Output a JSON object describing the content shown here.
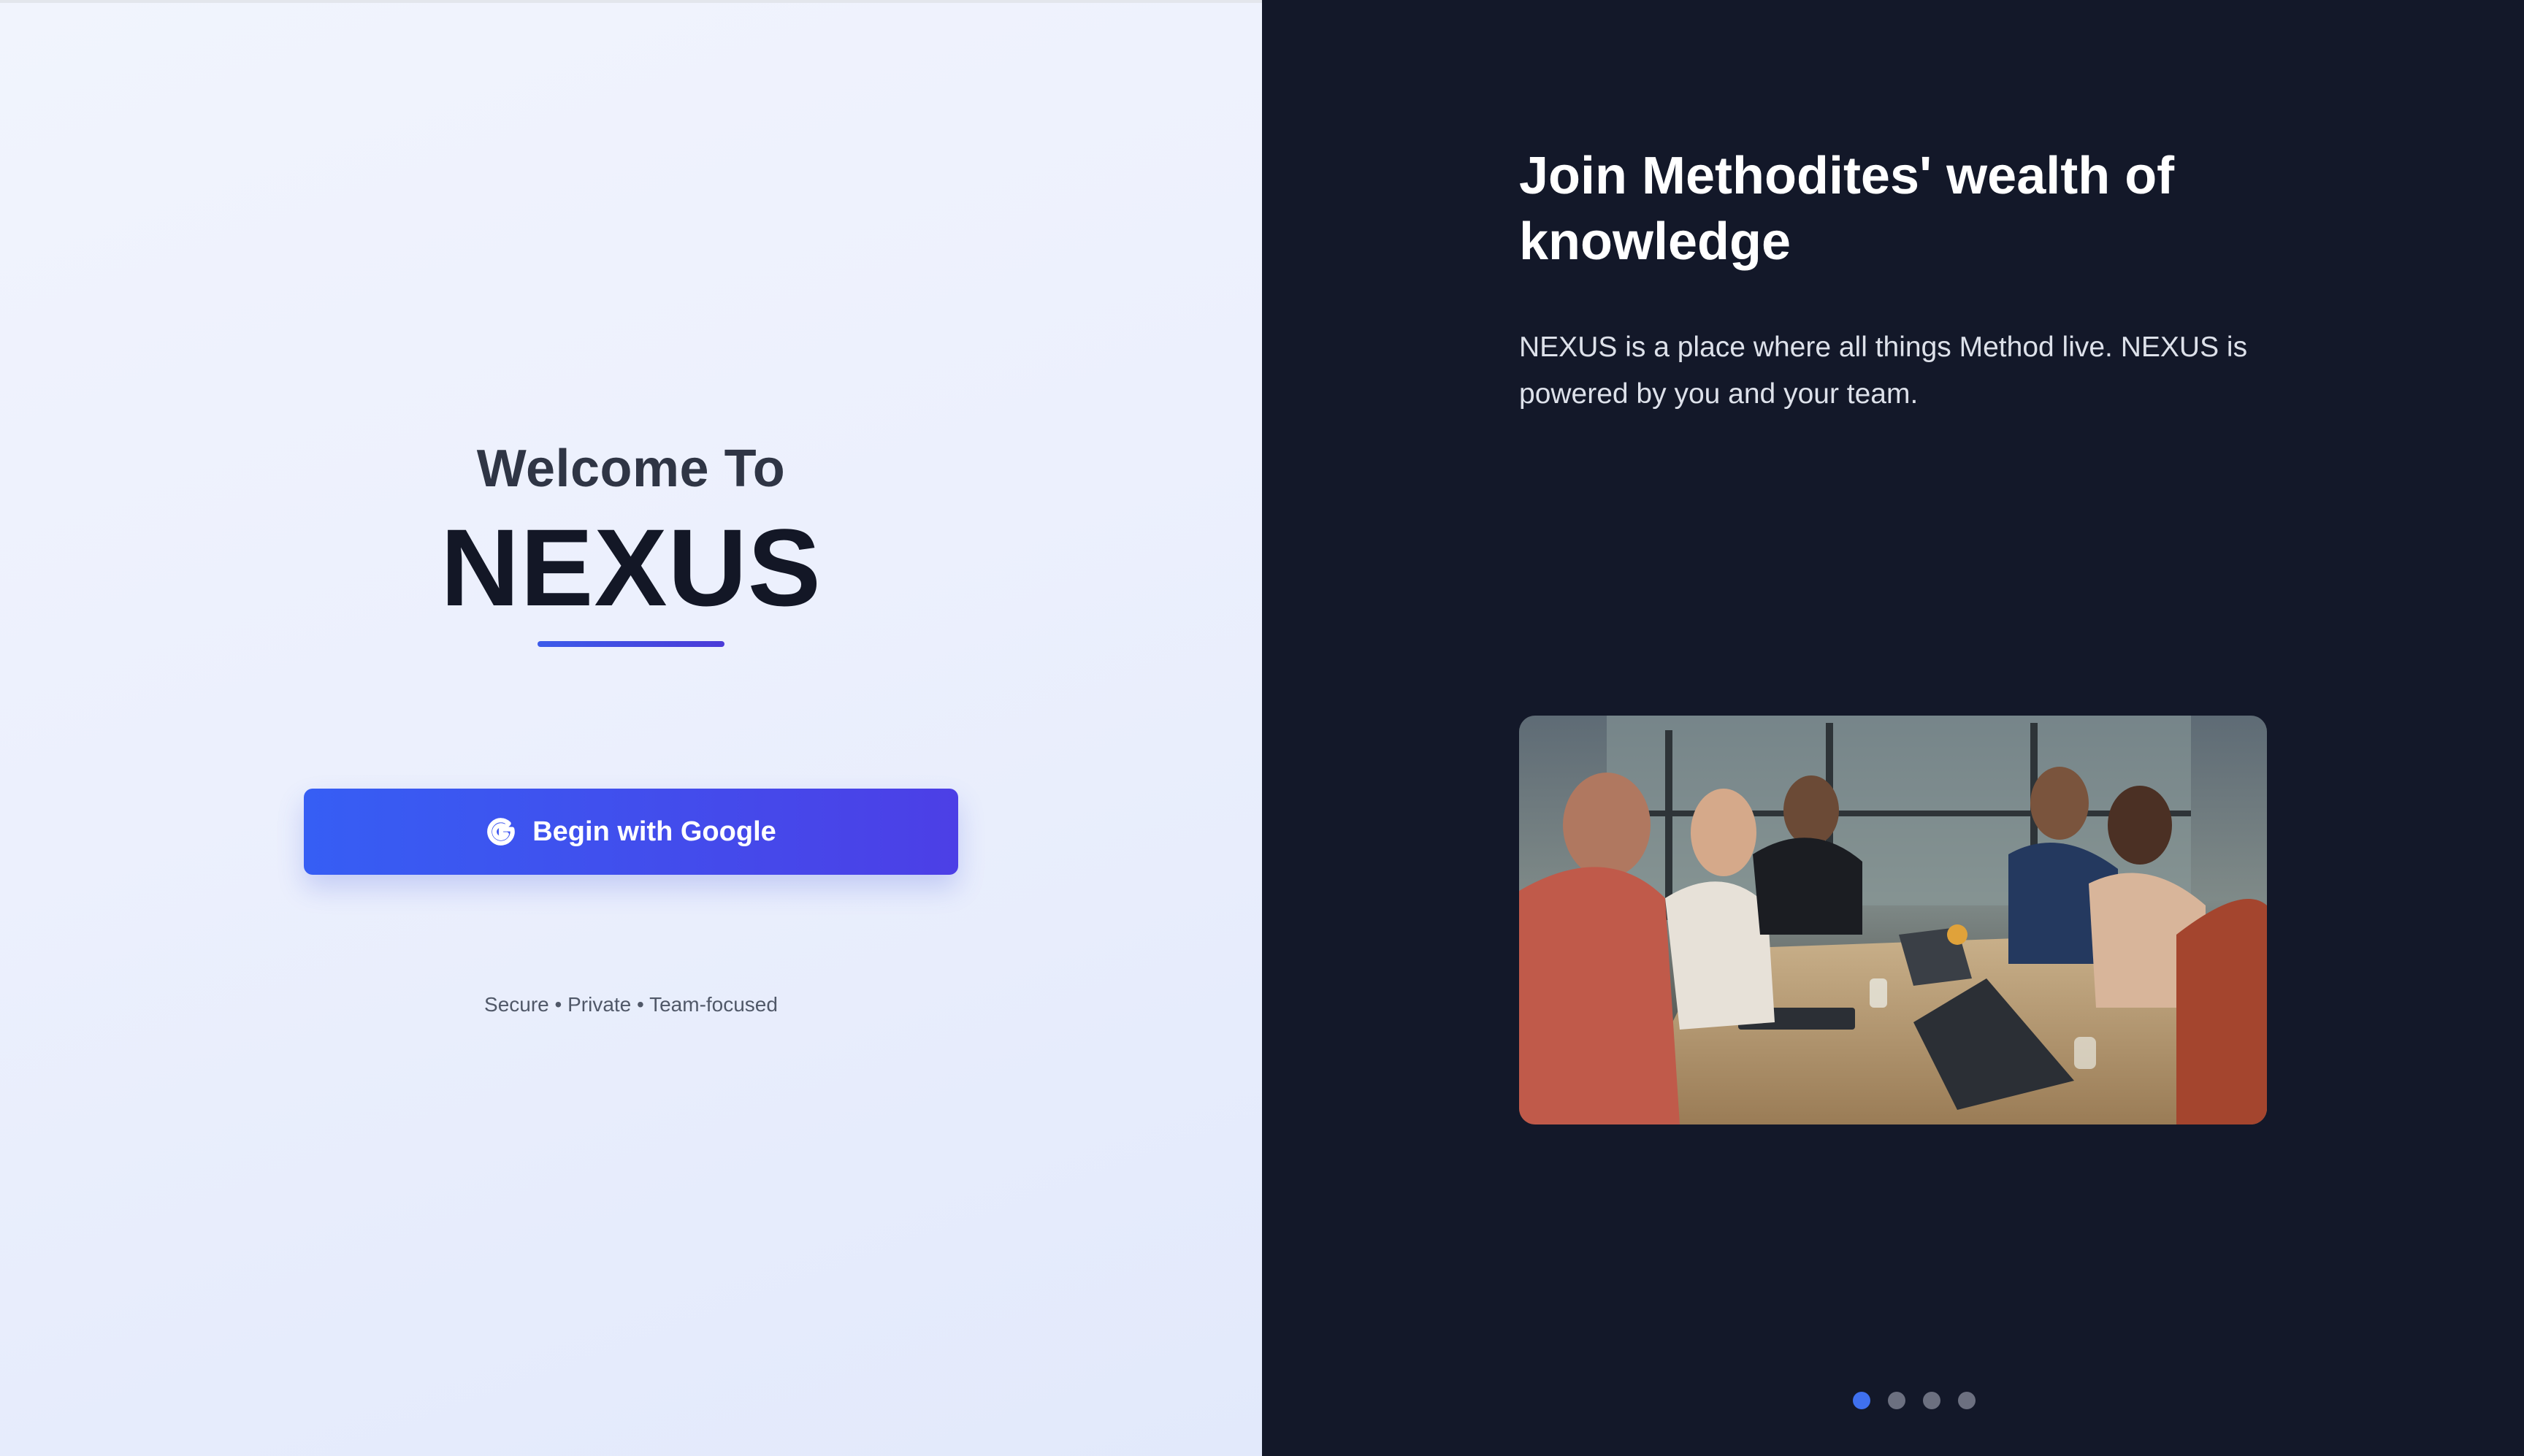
{
  "left": {
    "welcome_small": "Welcome To",
    "welcome_big": "NEXUS",
    "google_button_label": "Begin with Google",
    "tagline": "Secure • Private • Team-focused"
  },
  "right": {
    "title": "Join Methodites' wealth of knowledge",
    "description": "NEXUS is a place where all things Method live. NEXUS is powered by you and your team.",
    "image_alt": "Team meeting around a table with laptops",
    "carousel": {
      "count": 4,
      "active_index": 0
    }
  },
  "colors": {
    "accent": "#3c5bea",
    "accent_end": "#4c3fe6",
    "dark_panel": "#131829",
    "dot_active": "#3f70ee",
    "dot_inactive": "#6c7080"
  },
  "icons": {
    "google": "google-g-icon"
  }
}
